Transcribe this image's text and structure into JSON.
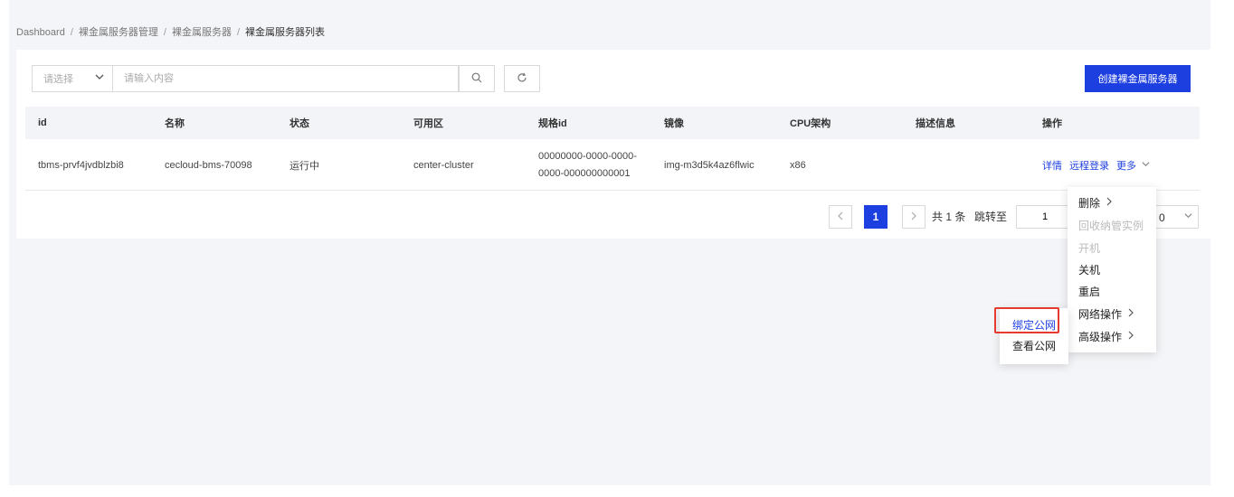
{
  "breadcrumb": [
    "Dashboard",
    "裸金属服务器管理",
    "裸金属服务器",
    "裸金属服务器列表"
  ],
  "breadcrumb_sep": "/",
  "toolbar": {
    "filter_placeholder": "请选择",
    "search_placeholder": "请输入内容",
    "create_label": "创建裸金属服务器"
  },
  "table": {
    "headers": [
      "id",
      "名称",
      "状态",
      "可用区",
      "规格id",
      "镜像",
      "CPU架构",
      "描述信息",
      "操作"
    ],
    "rows": [
      {
        "id": "tbms-prvf4jvdblzbi8",
        "name": "cecloud-bms-70098",
        "status": "运行中",
        "zone": "center-cluster",
        "spec_line1": "00000000-0000-0000-",
        "spec_line2": "0000-000000000001",
        "image": "img-m3d5k4az6flwic",
        "cpu": "x86",
        "desc": "",
        "op_detail": "详情",
        "op_remote": "远程登录",
        "op_more": "更多"
      }
    ]
  },
  "pagination": {
    "current_page": "1",
    "total_text": "共 1 条",
    "jump_label": "跳转至",
    "jump_value": "1",
    "page_size_partial": "0"
  },
  "more_menu": {
    "items": [
      {
        "label": "删除",
        "has_sub": true,
        "disabled": false
      },
      {
        "label": "回收纳管实例",
        "has_sub": false,
        "disabled": true
      },
      {
        "label": "开机",
        "has_sub": false,
        "disabled": true
      },
      {
        "label": "关机",
        "has_sub": false,
        "disabled": false
      },
      {
        "label": "重启",
        "has_sub": false,
        "disabled": false
      },
      {
        "label": "网络操作",
        "has_sub": true,
        "disabled": false
      },
      {
        "label": "高级操作",
        "has_sub": true,
        "disabled": false
      }
    ]
  },
  "network_submenu": {
    "items": [
      {
        "label": "绑定公网",
        "active": true
      },
      {
        "label": "查看公网",
        "active": false
      }
    ]
  },
  "colors": {
    "primary": "#1e3fe0",
    "highlight_border": "#e53a2f",
    "disabled_text": "#bbbbbb"
  },
  "icons": {
    "chev": "chevron-down-icon",
    "arrow": "chevron-right-icon"
  }
}
